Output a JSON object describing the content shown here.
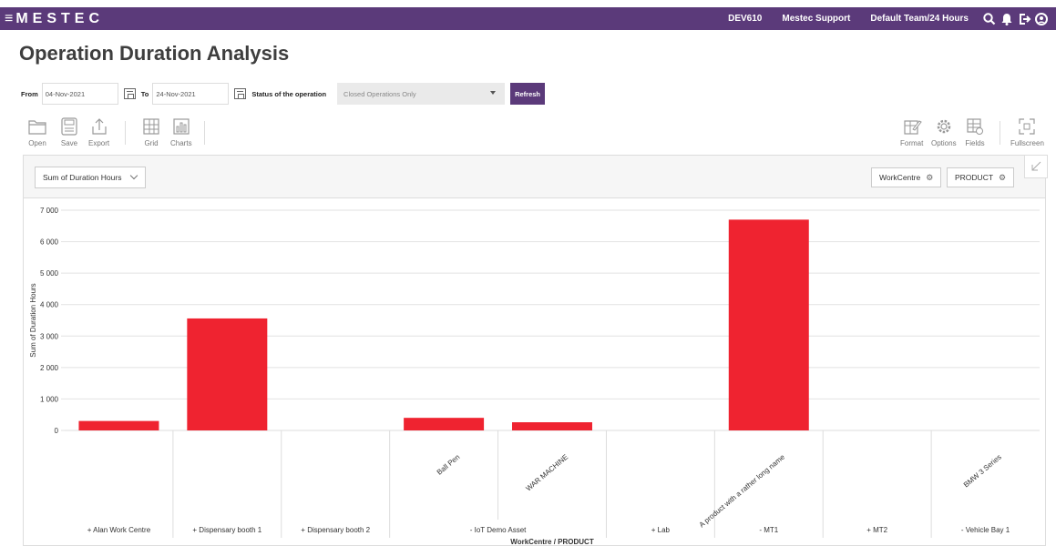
{
  "app": {
    "logo": "MESTEC",
    "menu_icon": "hamburger-icon",
    "env": "DEV610",
    "support": "Mestec Support",
    "team": "Default Team/24 Hours",
    "icons": [
      "search-icon",
      "bell-icon",
      "logout-icon",
      "user-icon"
    ]
  },
  "page": {
    "title": "Operation Duration Analysis"
  },
  "filters": {
    "from_label": "From",
    "from_value": "04-Nov-2021",
    "to_label": "To",
    "to_value": "24-Nov-2021",
    "status_label": "Status of the operation",
    "status_value": "Closed Operations Only",
    "refresh_label": "Refresh"
  },
  "toolbar": {
    "left": [
      {
        "label": "Open",
        "icon": "folder-icon"
      },
      {
        "label": "Save",
        "icon": "save-icon"
      },
      {
        "label": "Export",
        "icon": "export-icon"
      },
      {
        "label": "Grid",
        "icon": "grid-icon"
      },
      {
        "label": "Charts",
        "icon": "charts-icon"
      }
    ],
    "right": [
      {
        "label": "Format",
        "icon": "format-icon"
      },
      {
        "label": "Options",
        "icon": "options-gear-icon"
      },
      {
        "label": "Fields",
        "icon": "fields-icon"
      },
      {
        "label": "Fullscreen",
        "icon": "fullscreen-icon"
      }
    ]
  },
  "panel": {
    "measure": "Sum of Duration Hours",
    "row_fields": [
      "WorkCentre",
      "PRODUCT"
    ]
  },
  "colors": {
    "bar": "#ef2330",
    "brand": "#5b3a7a"
  },
  "chart_data": {
    "type": "bar",
    "ylabel": "Sum of Duration Hours",
    "xlabel": "WorkCentre / PRODUCT",
    "ylim": [
      0,
      7000
    ],
    "yticks": [
      0,
      1000,
      2000,
      3000,
      4000,
      5000,
      6000,
      7000
    ],
    "ytick_labels": [
      "0",
      "1 000",
      "2 000",
      "3 000",
      "4 000",
      "5 000",
      "6 000",
      "7 000"
    ],
    "grid": true,
    "groups": [
      {
        "label": "+ Alan Work Centre",
        "items": [
          {
            "name": "",
            "value": 300
          }
        ]
      },
      {
        "label": "+ Dispensary booth 1",
        "items": [
          {
            "name": "",
            "value": 3560
          }
        ]
      },
      {
        "label": "+ Dispensary booth 2",
        "items": [
          {
            "name": "",
            "value": 0
          }
        ]
      },
      {
        "label": "- IoT Demo Asset",
        "items": [
          {
            "name": "Ball Pen",
            "value": 400
          },
          {
            "name": "WAR MACHINE",
            "value": 260
          }
        ]
      },
      {
        "label": "+ Lab",
        "items": [
          {
            "name": "",
            "value": 0
          }
        ]
      },
      {
        "label": "- MT1",
        "items": [
          {
            "name": "A product with a rather long name",
            "value": 6700
          }
        ]
      },
      {
        "label": "+ MT2",
        "items": [
          {
            "name": "",
            "value": 0
          }
        ]
      },
      {
        "label": "- Vehicle Bay 1",
        "items": [
          {
            "name": "BMW 3 Series",
            "value": 0
          }
        ]
      }
    ]
  }
}
